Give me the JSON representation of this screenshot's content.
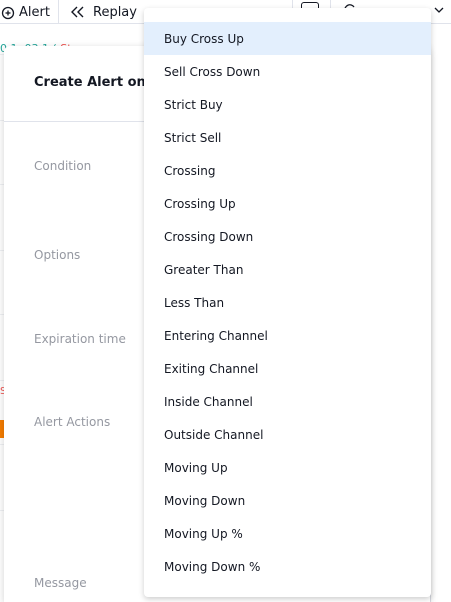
{
  "toolbar": {
    "alert_label": "Alert",
    "replay_label": "Replay"
  },
  "chart_background": {
    "ticker_text": "0 1 .03 1 (",
    "ticker_red": "Stra",
    "marks": [
      "S"
    ]
  },
  "dialog": {
    "title": "Create Alert on X",
    "labels": {
      "condition": "Condition",
      "options": "Options",
      "expiration": "Expiration time",
      "actions": "Alert Actions",
      "message": "Message"
    }
  },
  "dropdown": {
    "selected_index": 0,
    "items": [
      "Buy Cross Up",
      "Sell Cross Down",
      "Strict Buy",
      "Strict Sell",
      "Crossing",
      "Crossing Up",
      "Crossing Down",
      "Greater Than",
      "Less Than",
      "Entering Channel",
      "Exiting Channel",
      "Inside Channel",
      "Outside Channel",
      "Moving Up",
      "Moving Down",
      "Moving Up %",
      "Moving Down %"
    ]
  },
  "colors": {
    "accent_selected": "#e3effd",
    "text_primary": "#131722",
    "text_muted": "#9598a1",
    "ticker_green": "#26a69a",
    "ticker_red": "#ef5350"
  }
}
